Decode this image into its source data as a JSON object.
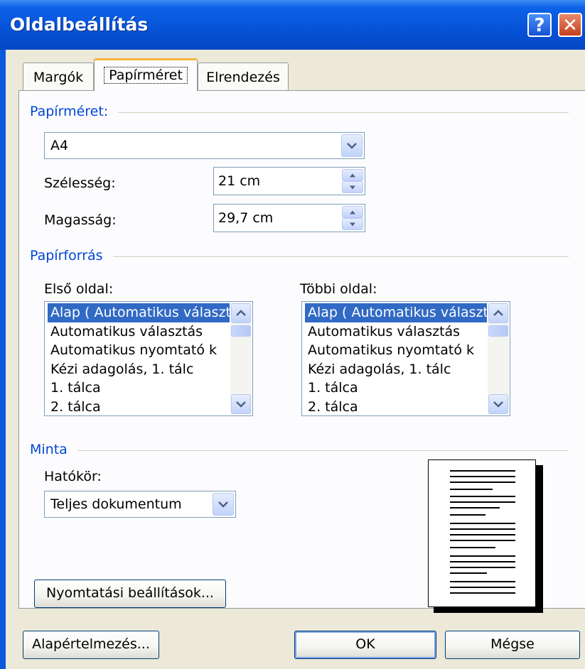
{
  "window": {
    "title": "Oldalbeállítás",
    "help_glyph": "?",
    "close_glyph": "✕"
  },
  "tabs": [
    {
      "label": "Margók"
    },
    {
      "label": "Papírméret"
    },
    {
      "label": "Elrendezés"
    }
  ],
  "paper_size": {
    "group_label": "Papírméret:",
    "selected": "A4",
    "width_label": "Szélesség:",
    "width_value": "21 cm",
    "height_label": "Magasság:",
    "height_value": "29,7 cm"
  },
  "paper_source": {
    "group_label": "Papírforrás",
    "first_page_label": "Első oldal:",
    "other_pages_label": "Többi oldal:",
    "items": [
      "Alap ( Automatikus választás",
      "Automatikus választás",
      "Automatikus nyomtató k",
      "Kézi adagolás, 1. tálc",
      "1. tálca",
      "2. tálca"
    ],
    "selected_index": 0
  },
  "preview": {
    "group_label": "Minta",
    "scope_label": "Hatókör:",
    "scope_value": "Teljes dokumentum"
  },
  "buttons": {
    "print_options": "Nyomtatási beállítások...",
    "default": "Alapértelmezés...",
    "ok": "OK",
    "cancel": "Mégse"
  },
  "colors": {
    "titlebar": "#0552d6",
    "group_label": "#0046d5",
    "selection": "#316ac5",
    "active_tab_accent": "#f5b53a"
  }
}
